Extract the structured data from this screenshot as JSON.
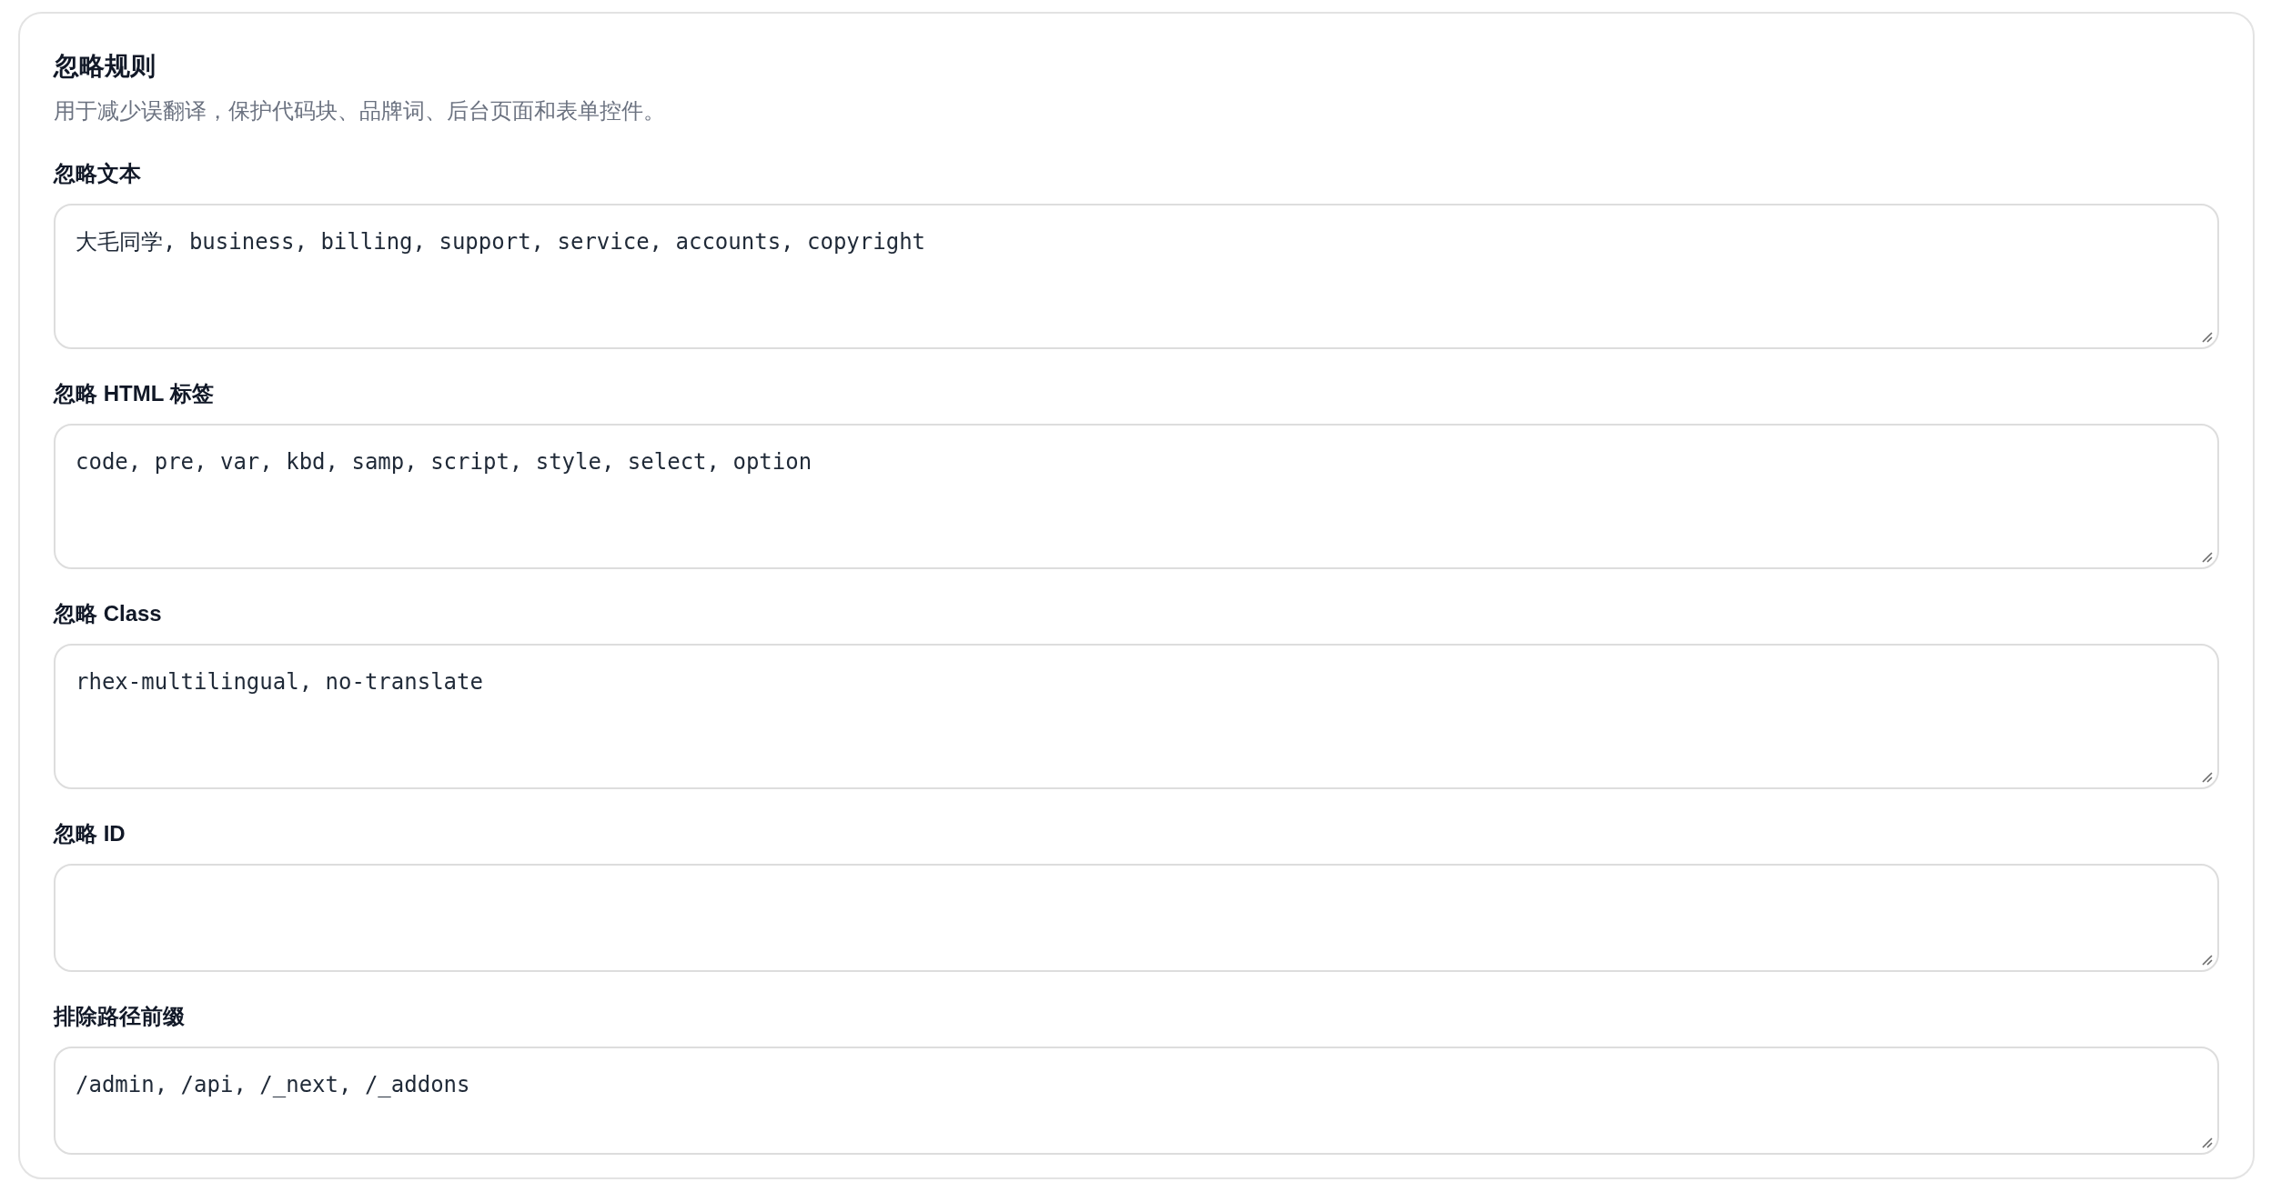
{
  "section": {
    "title": "忽略规则",
    "description": "用于减少误翻译，保护代码块、品牌词、后台页面和表单控件。",
    "fields": [
      {
        "label": "忽略文本",
        "value": "大毛同学, business, billing, support, service, accounts, copyright"
      },
      {
        "label": "忽略 HTML 标签",
        "value": "code, pre, var, kbd, samp, script, style, select, option"
      },
      {
        "label": "忽略 Class",
        "value": "rhex-multilingual, no-translate"
      },
      {
        "label": "忽略 ID"
      },
      {
        "label": "排除路径前缀",
        "value": "/admin, /api, /_next, /_addons"
      }
    ]
  }
}
